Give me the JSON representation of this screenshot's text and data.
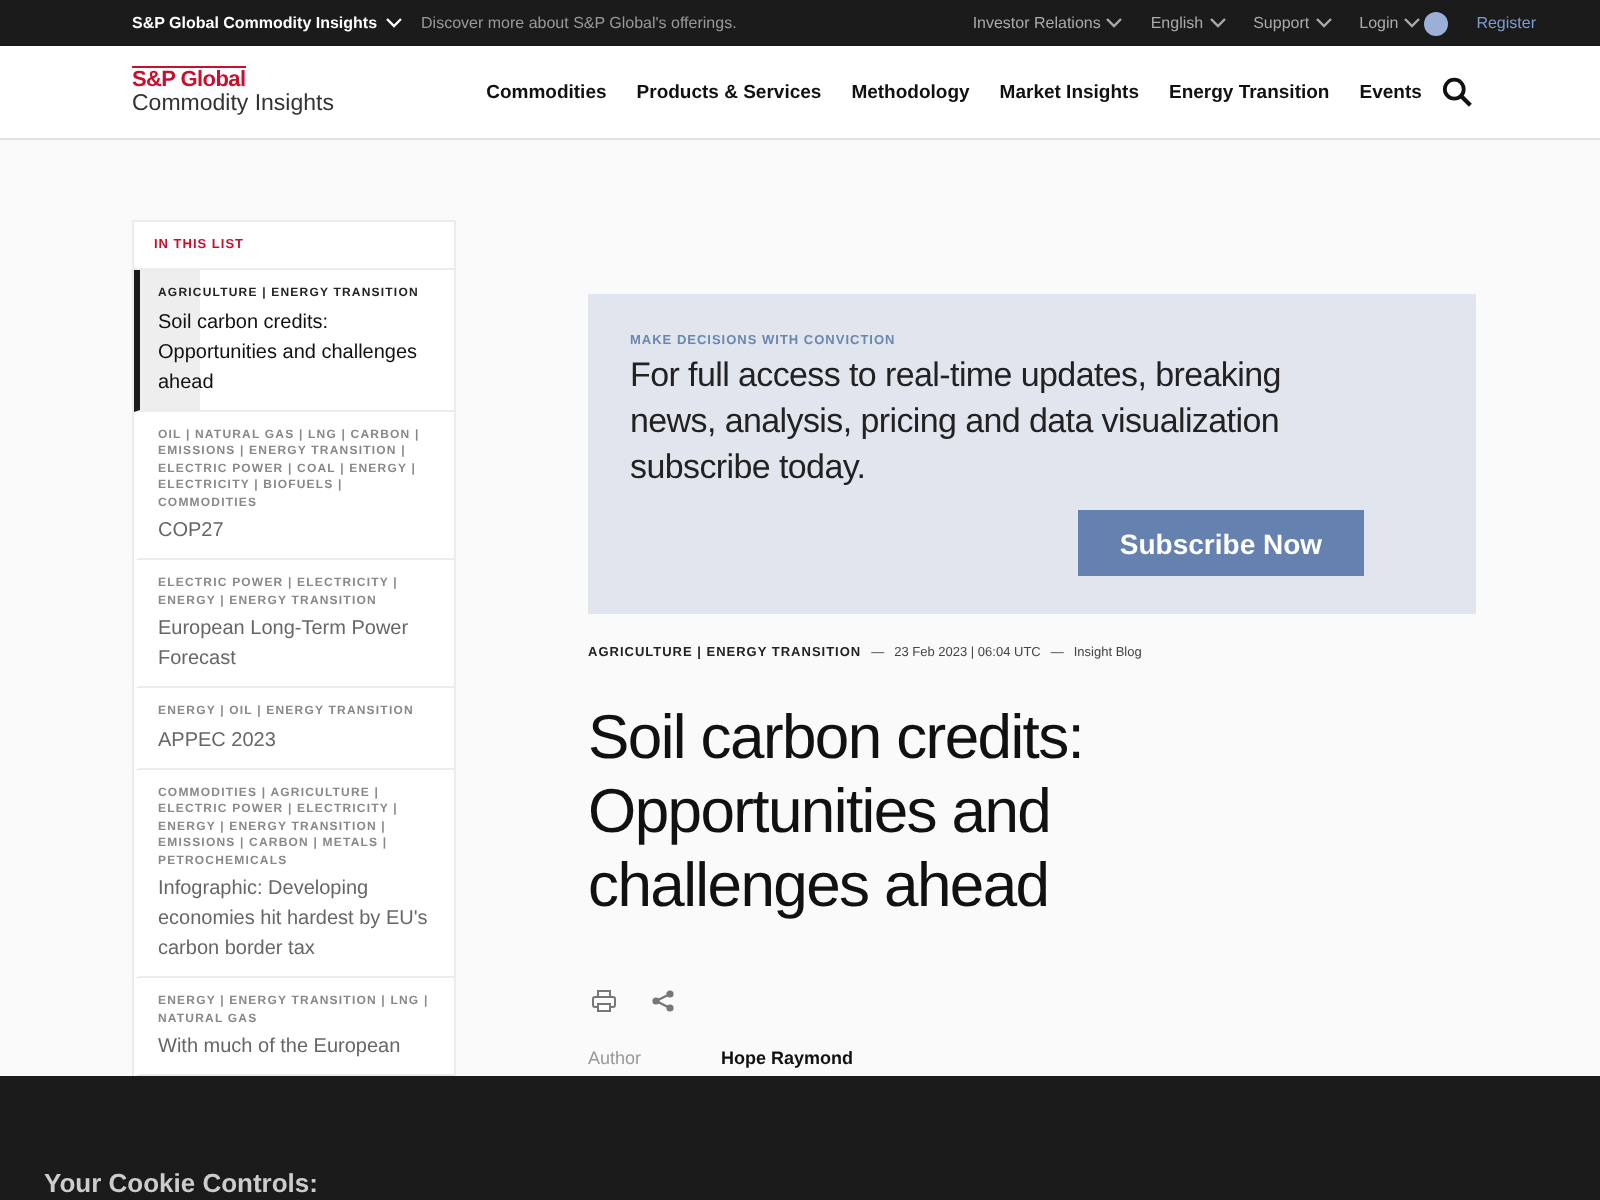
{
  "top_bar": {
    "brand": "S&P Global Commodity Insights",
    "tagline": "Discover more about S&P Global's offerings.",
    "links": [
      "Investor Relations",
      "English",
      "Support",
      "Login"
    ],
    "register": "Register"
  },
  "header": {
    "logo_line1": "S&P Global",
    "logo_line2": "Commodity Insights",
    "nav": [
      "Commodities",
      "Products & Services",
      "Methodology",
      "Market Insights",
      "Energy Transition",
      "Events"
    ]
  },
  "sidebar": {
    "heading": "IN THIS LIST",
    "items": [
      {
        "tags": "AGRICULTURE | ENERGY TRANSITION",
        "title": "Soil carbon credits: Opportunities and challenges ahead",
        "selected": true
      },
      {
        "tags": "OIL | NATURAL GAS | LNG | CARBON | EMISSIONS | ENERGY TRANSITION | ELECTRIC POWER | COAL | ENERGY | ELECTRICITY | BIOFUELS | COMMODITIES",
        "title": "COP27",
        "selected": false
      },
      {
        "tags": "ELECTRIC POWER | ELECTRICITY | ENERGY | ENERGY TRANSITION",
        "title": "European Long-Term Power Forecast",
        "selected": false
      },
      {
        "tags": "ENERGY | OIL | ENERGY TRANSITION",
        "title": "APPEC 2023",
        "selected": false
      },
      {
        "tags": "COMMODITIES | AGRICULTURE | ELECTRIC POWER | ELECTRICITY | ENERGY | ENERGY TRANSITION | EMISSIONS | CARBON | METALS | PETROCHEMICALS",
        "title": "Infographic: Developing economies hit hardest by EU's carbon border tax",
        "selected": false
      },
      {
        "tags": "ENERGY | ENERGY TRANSITION | LNG | NATURAL GAS",
        "title": "With much of the European",
        "selected": false
      }
    ]
  },
  "promo": {
    "eyebrow": "MAKE DECISIONS WITH CONVICTION",
    "text": "For full access to real-time updates, breaking news, analysis, pricing and data visualization subscribe today.",
    "button": "Subscribe Now"
  },
  "article": {
    "tags": "AGRICULTURE | ENERGY TRANSITION",
    "separator": "—",
    "date": "23 Feb 2023 | 06:04 UTC",
    "type": "Insight Blog",
    "title": "Soil carbon credits: Opportunities and challenges ahead",
    "author_label": "Author",
    "author": "Hope Raymond"
  },
  "cookie_banner": {
    "title": "Your Cookie Controls:"
  }
}
